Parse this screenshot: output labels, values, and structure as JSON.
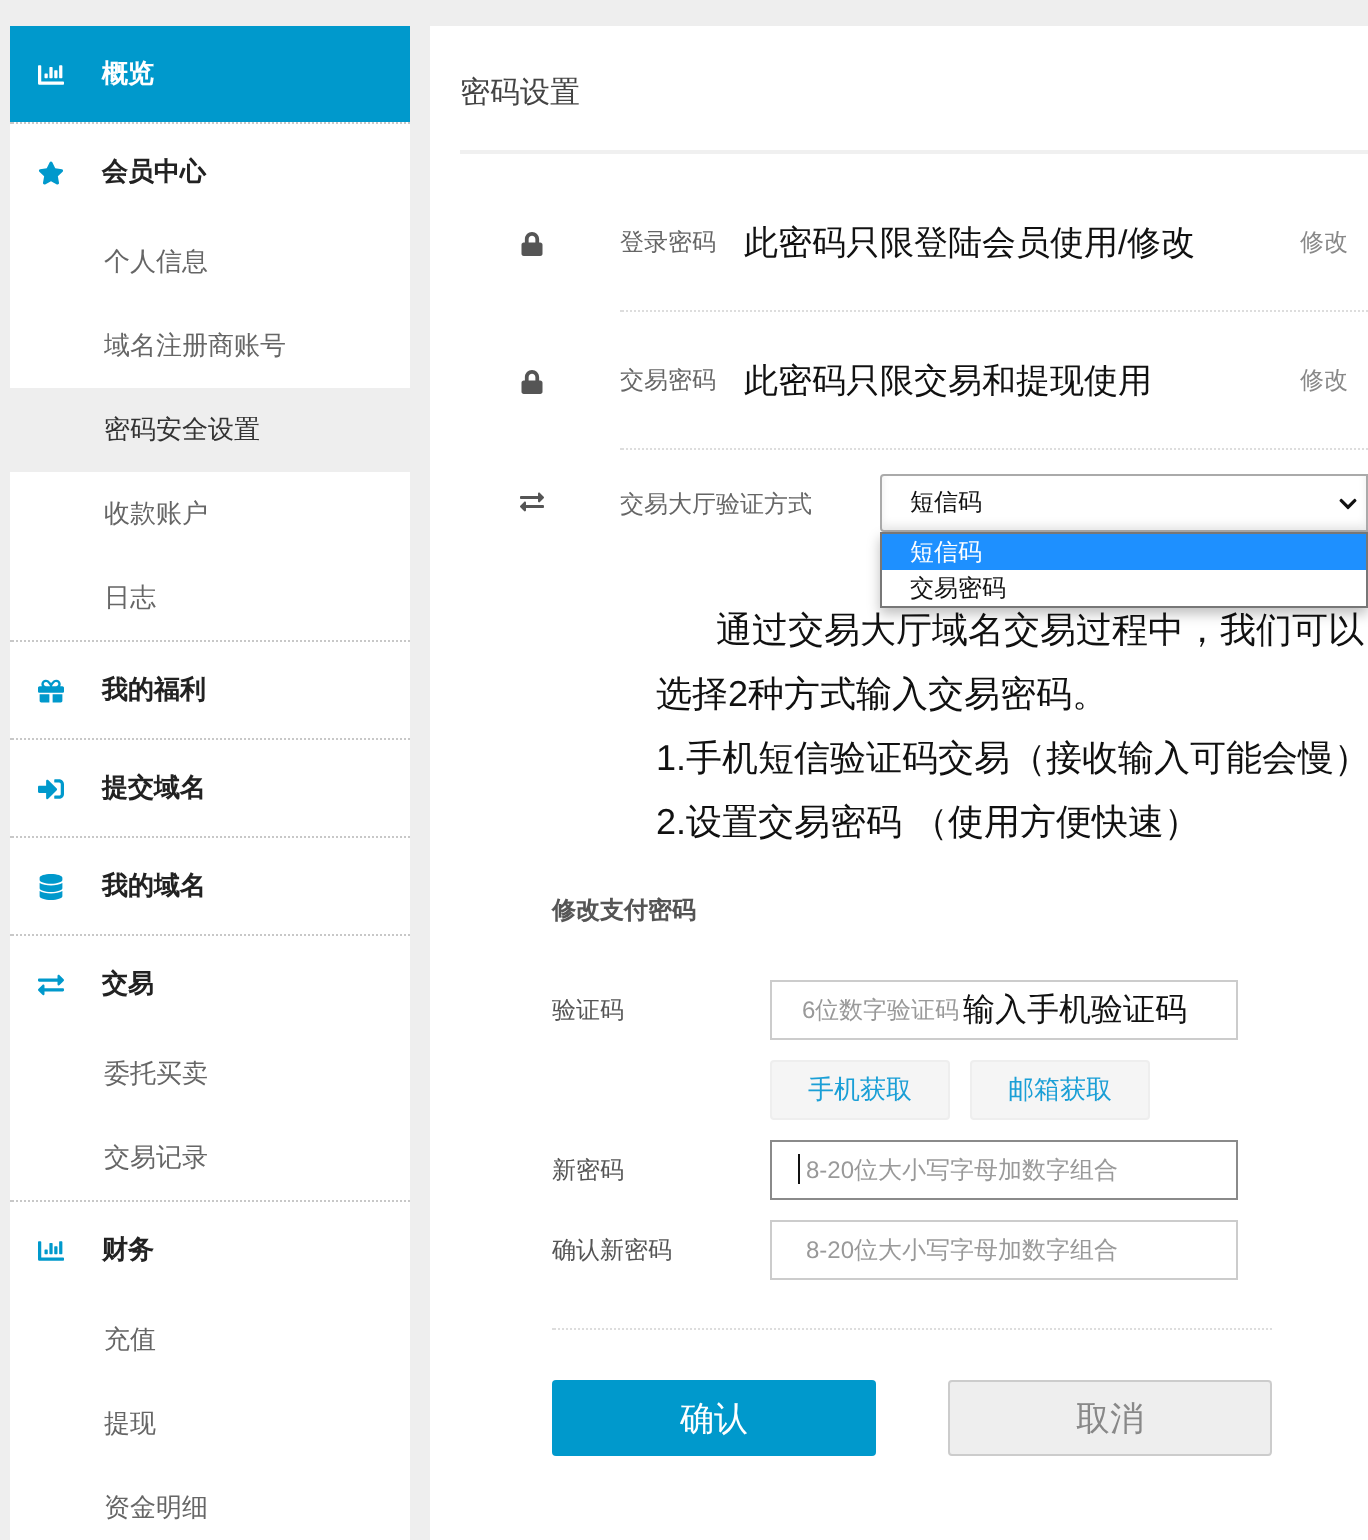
{
  "sidebar": {
    "groups": [
      {
        "label": "概览",
        "selected": true
      },
      {
        "label": "会员中心",
        "selected": false,
        "items": [
          {
            "label": "个人信息",
            "selected": false
          },
          {
            "label": "域名注册商账号",
            "selected": false
          },
          {
            "label": "密码安全设置",
            "selected": true
          },
          {
            "label": "收款账户",
            "selected": false
          },
          {
            "label": "日志",
            "selected": false
          }
        ]
      },
      {
        "label": "我的福利",
        "selected": false
      },
      {
        "label": "提交域名",
        "selected": false
      },
      {
        "label": "我的域名",
        "selected": false
      },
      {
        "label": "交易",
        "selected": false,
        "items": [
          {
            "label": "委托买卖",
            "selected": false
          },
          {
            "label": "交易记录",
            "selected": false
          }
        ]
      },
      {
        "label": "财务",
        "selected": false,
        "items": [
          {
            "label": "充值",
            "selected": false
          },
          {
            "label": "提现",
            "selected": false
          },
          {
            "label": "资金明细",
            "selected": false
          }
        ]
      }
    ]
  },
  "main": {
    "title": "密码设置",
    "password_rows": [
      {
        "label": "登录密码",
        "description": "此密码只限登陆会员使用/修改",
        "action": "修改"
      },
      {
        "label": "交易密码",
        "description": "此密码只限交易和提现使用",
        "action": "修改"
      }
    ],
    "verify_method": {
      "label": "交易大厅验证方式",
      "value": "短信码",
      "expanded": true,
      "options": [
        {
          "label": "短信码",
          "selected": true
        },
        {
          "label": "交易密码",
          "selected": false
        }
      ]
    },
    "notice": [
      "通过交易大厅域名交易过程中，我们可以选择2种方式输入交易密码。",
      "1.手机短信验证码交易（接收输入可能会慢）",
      "2.设置交易密码 （使用方便快速）"
    ],
    "form": {
      "title": "修改支付密码",
      "code": {
        "label": "验证码",
        "placeholder": "6位数字验证码",
        "annotation": "输入手机验证码"
      },
      "code_buttons": [
        "手机获取",
        "邮箱获取"
      ],
      "fields": [
        {
          "label": "新密码",
          "placeholder": "8-20位大小写字母加数字组合",
          "focused": true
        },
        {
          "label": "确认新密码",
          "placeholder": "8-20位大小写字母加数字组合",
          "focused": false
        }
      ],
      "confirm": "确认",
      "cancel": "取消"
    }
  }
}
